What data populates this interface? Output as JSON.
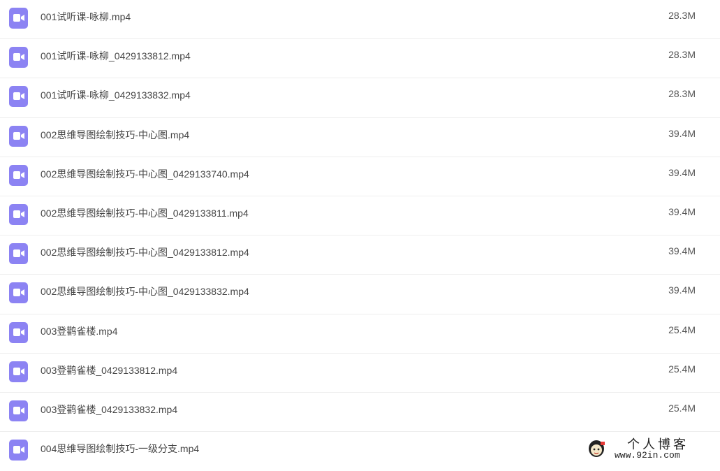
{
  "files": [
    {
      "name": "001试听课-咏柳.mp4",
      "size": "28.3M"
    },
    {
      "name": "001试听课-咏柳_0429133812.mp4",
      "size": "28.3M"
    },
    {
      "name": "001试听课-咏柳_0429133832.mp4",
      "size": "28.3M"
    },
    {
      "name": "002思维导图绘制技巧-中心图.mp4",
      "size": "39.4M"
    },
    {
      "name": "002思维导图绘制技巧-中心图_0429133740.mp4",
      "size": "39.4M"
    },
    {
      "name": "002思维导图绘制技巧-中心图_0429133811.mp4",
      "size": "39.4M"
    },
    {
      "name": "002思维导图绘制技巧-中心图_0429133812.mp4",
      "size": "39.4M"
    },
    {
      "name": "002思维导图绘制技巧-中心图_0429133832.mp4",
      "size": "39.4M"
    },
    {
      "name": "003登鹳雀楼.mp4",
      "size": "25.4M"
    },
    {
      "name": "003登鹳雀楼_0429133812.mp4",
      "size": "25.4M"
    },
    {
      "name": "003登鹳雀楼_0429133832.mp4",
      "size": "25.4M"
    },
    {
      "name": "004思维导图绘制技巧-一级分支.mp4",
      "size": ""
    }
  ],
  "icon": {
    "name": "video-file-icon",
    "color": "#8c83f3"
  },
  "watermark": {
    "title": "个人博客",
    "url": "www.92in.com"
  }
}
